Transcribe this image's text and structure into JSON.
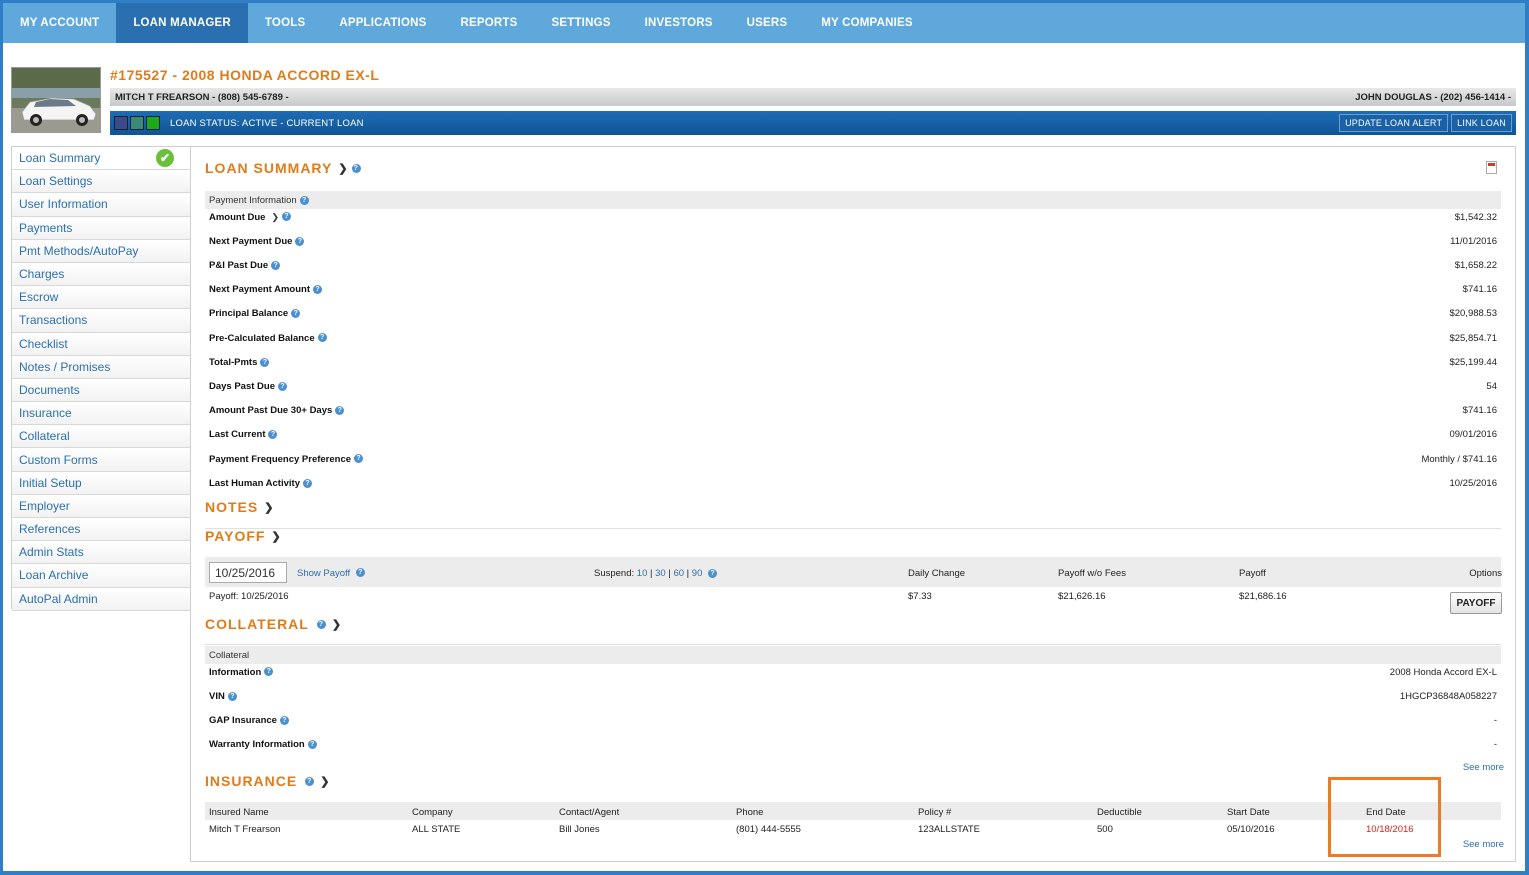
{
  "nav": {
    "items": [
      "MY ACCOUNT",
      "LOAN MANAGER",
      "TOOLS",
      "APPLICATIONS",
      "REPORTS",
      "SETTINGS",
      "INVESTORS",
      "USERS",
      "MY COMPANIES"
    ],
    "active": "LOAN MANAGER"
  },
  "loan": {
    "title": "#175527 - 2008 HONDA ACCORD EX-L",
    "borrower": "MITCH T FREARSON - (808) 545-6789 -",
    "cosigner": "JOHN DOUGLAS - (202) 456-1414 -",
    "status": "LOAN STATUS: ACTIVE - CURRENT LOAN",
    "update_alert_label": "UPDATE LOAN ALERT",
    "link_loan_label": "LINK LOAN",
    "status_squares": [
      "#3a4a8a",
      "#3a8a7a",
      "#1aaa1a"
    ]
  },
  "sidebar": {
    "items": [
      "Loan Summary",
      "Loan Settings",
      "User Information",
      "Payments",
      "Pmt Methods/AutoPay",
      "Charges",
      "Escrow",
      "Transactions",
      "Checklist",
      "Notes / Promises",
      "Documents",
      "Insurance",
      "Collateral",
      "Custom Forms",
      "Initial Setup",
      "Employer",
      "References",
      "Admin Stats",
      "Loan Archive",
      "AutoPal Admin"
    ]
  },
  "loan_summary": {
    "heading": "LOAN SUMMARY",
    "group_label": "Payment Information",
    "rows": [
      {
        "label": "Amount Due",
        "value": "$1,542.32"
      },
      {
        "label": "Next Payment Due",
        "value": "11/01/2016"
      },
      {
        "label": "P&I Past Due",
        "value": "$1,658.22"
      },
      {
        "label": "Next Payment Amount",
        "value": "$741.16"
      },
      {
        "label": "Principal Balance",
        "value": "$20,988.53"
      },
      {
        "label": "Pre-Calculated Balance",
        "value": "$25,854.71"
      },
      {
        "label": "Total-Pmts",
        "value": "$25,199.44"
      },
      {
        "label": "Days Past Due",
        "value": "54"
      },
      {
        "label": "Amount Past Due 30+ Days",
        "value": "$741.16"
      },
      {
        "label": "Last Current",
        "value": "09/01/2016"
      },
      {
        "label": "Payment Frequency Preference",
        "value": "Monthly / $741.16"
      },
      {
        "label": "Last Human Activity",
        "value": "10/25/2016"
      }
    ]
  },
  "notes": {
    "heading": "NOTES"
  },
  "payoff": {
    "heading": "PAYOFF",
    "date_value": "10/25/2016",
    "show_payoff": "Show Payoff",
    "suspend_label": "Suspend:",
    "suspend_options": [
      "10",
      "30",
      "60",
      "90"
    ],
    "daily_change_label": "Daily Change",
    "payoff_wo_fees_label": "Payoff w/o Fees",
    "payoff_label": "Payoff",
    "options_label": "Options",
    "row_date": "Payoff: 10/25/2016",
    "daily_change": "$7.33",
    "payoff_wo_fees": "$21,626.16",
    "payoff_value": "$21,686.16",
    "button": "PAYOFF"
  },
  "collateral": {
    "heading": "COLLATERAL",
    "group_label": "Collateral",
    "rows": [
      {
        "label": "Information",
        "value": "2008 Honda Accord EX-L"
      },
      {
        "label": "VIN",
        "value": "1HGCP36848A058227"
      },
      {
        "label": "GAP Insurance",
        "value": "-"
      },
      {
        "label": "Warranty Information",
        "value": "-"
      }
    ],
    "see_more": "See more"
  },
  "insurance": {
    "heading": "INSURANCE",
    "columns": [
      "Insured Name",
      "Company",
      "Contact/Agent",
      "Phone",
      "Policy #",
      "Deductible",
      "Start Date",
      "End Date"
    ],
    "rows": [
      [
        "Mitch T Frearson",
        "ALL STATE",
        "Bill Jones",
        "(801) 444-5555",
        "123ALLSTATE",
        "500",
        "05/10/2016",
        "10/18/2016"
      ]
    ],
    "see_more": "See more",
    "highlight_color": "#f07a22",
    "end_date_color": "#e0201a"
  }
}
